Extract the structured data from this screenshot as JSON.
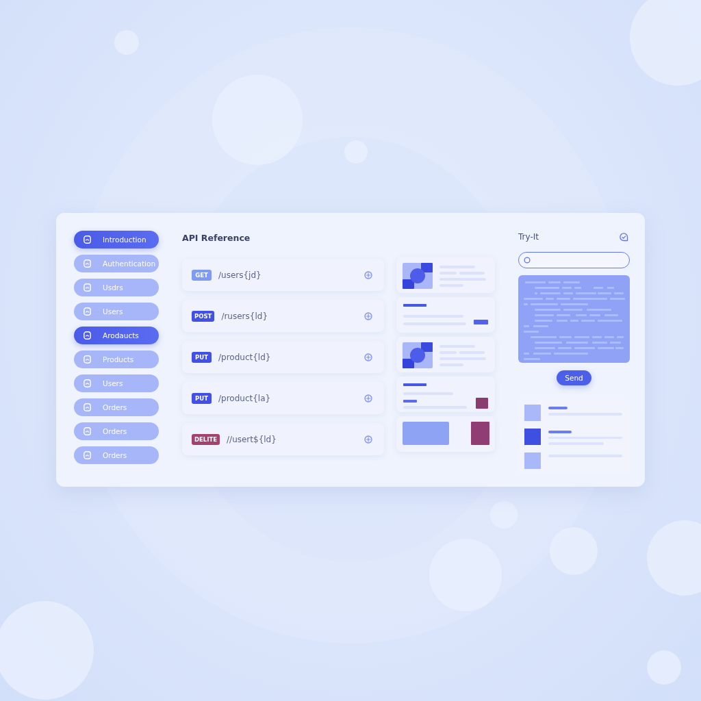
{
  "sidebar": {
    "items": [
      {
        "label": "Introduction",
        "selected": true
      },
      {
        "label": "Authentication",
        "selected": false
      },
      {
        "label": "Usdrs",
        "selected": false
      },
      {
        "label": "Users",
        "selected": false
      },
      {
        "label": "Arodaucts",
        "selected": true
      },
      {
        "label": "Products",
        "selected": false
      },
      {
        "label": "Users",
        "selected": false
      },
      {
        "label": "Orders",
        "selected": false
      },
      {
        "label": "Orders",
        "selected": false
      },
      {
        "label": "Orders",
        "selected": false
      }
    ]
  },
  "reference": {
    "title": "API Reference",
    "endpoints": [
      {
        "method": "GET",
        "color": "#7e9af3",
        "path": "/users{jd}"
      },
      {
        "method": "POST",
        "color": "#4150e6",
        "path": "/rusers{ld}"
      },
      {
        "method": "PUT",
        "color": "#4150e6",
        "path": "/product{ld}"
      },
      {
        "method": "PUT",
        "color": "#4150e6",
        "path": "/product{la}"
      },
      {
        "method": "DELITE",
        "color": "#a3416f",
        "path": "//usert${ld}"
      }
    ]
  },
  "previews": [
    {
      "kind": "media"
    },
    {
      "kind": "text"
    },
    {
      "kind": "media"
    },
    {
      "kind": "swatch"
    },
    {
      "kind": "blocks"
    }
  ],
  "try_it": {
    "title": "Try-It",
    "send_button": "Send",
    "results": [
      {
        "kind": "titled",
        "selected": false
      },
      {
        "kind": "detailed",
        "selected": true
      },
      {
        "kind": "plain",
        "selected": false
      }
    ]
  }
}
